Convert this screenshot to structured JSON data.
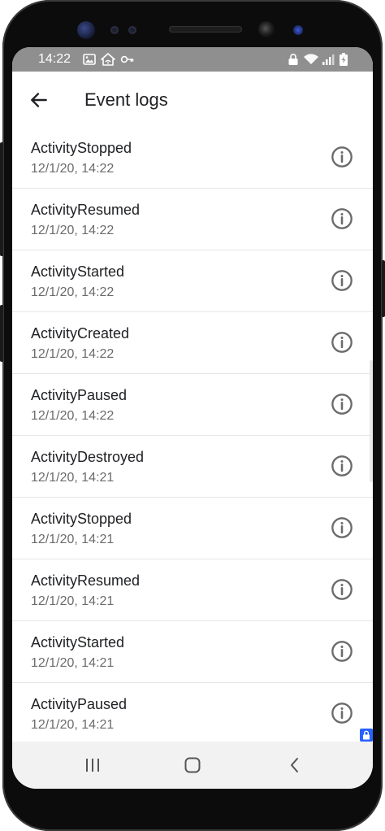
{
  "status_bar": {
    "time": "14:22",
    "left_icons": [
      "image-icon",
      "home-network-icon",
      "key-icon"
    ],
    "right_icons": [
      "lock-icon",
      "wifi-icon",
      "signal-icon",
      "battery-charging-icon"
    ]
  },
  "app_bar": {
    "title": "Event logs",
    "back_icon": "arrow-back-icon"
  },
  "events": [
    {
      "name": "ActivityStopped",
      "time": "12/1/20, 14:22"
    },
    {
      "name": "ActivityResumed",
      "time": "12/1/20, 14:22"
    },
    {
      "name": "ActivityStarted",
      "time": "12/1/20, 14:22"
    },
    {
      "name": "ActivityCreated",
      "time": "12/1/20, 14:22"
    },
    {
      "name": "ActivityPaused",
      "time": "12/1/20, 14:22"
    },
    {
      "name": "ActivityDestroyed",
      "time": "12/1/20, 14:21"
    },
    {
      "name": "ActivityStopped",
      "time": "12/1/20, 14:21"
    },
    {
      "name": "ActivityResumed",
      "time": "12/1/20, 14:21"
    },
    {
      "name": "ActivityStarted",
      "time": "12/1/20, 14:21"
    },
    {
      "name": "ActivityPaused",
      "time": "12/1/20, 14:21"
    }
  ],
  "nav_bar": {
    "buttons": [
      "recents-icon",
      "home-icon",
      "back-icon"
    ]
  },
  "colors": {
    "status_bar": "#8f8f8f",
    "text_primary": "#202124",
    "text_secondary": "#6b6b6b",
    "icon": "#6b6b6b",
    "nav_bar": "#f2f2f2",
    "lock_badge": "#2962ff"
  }
}
